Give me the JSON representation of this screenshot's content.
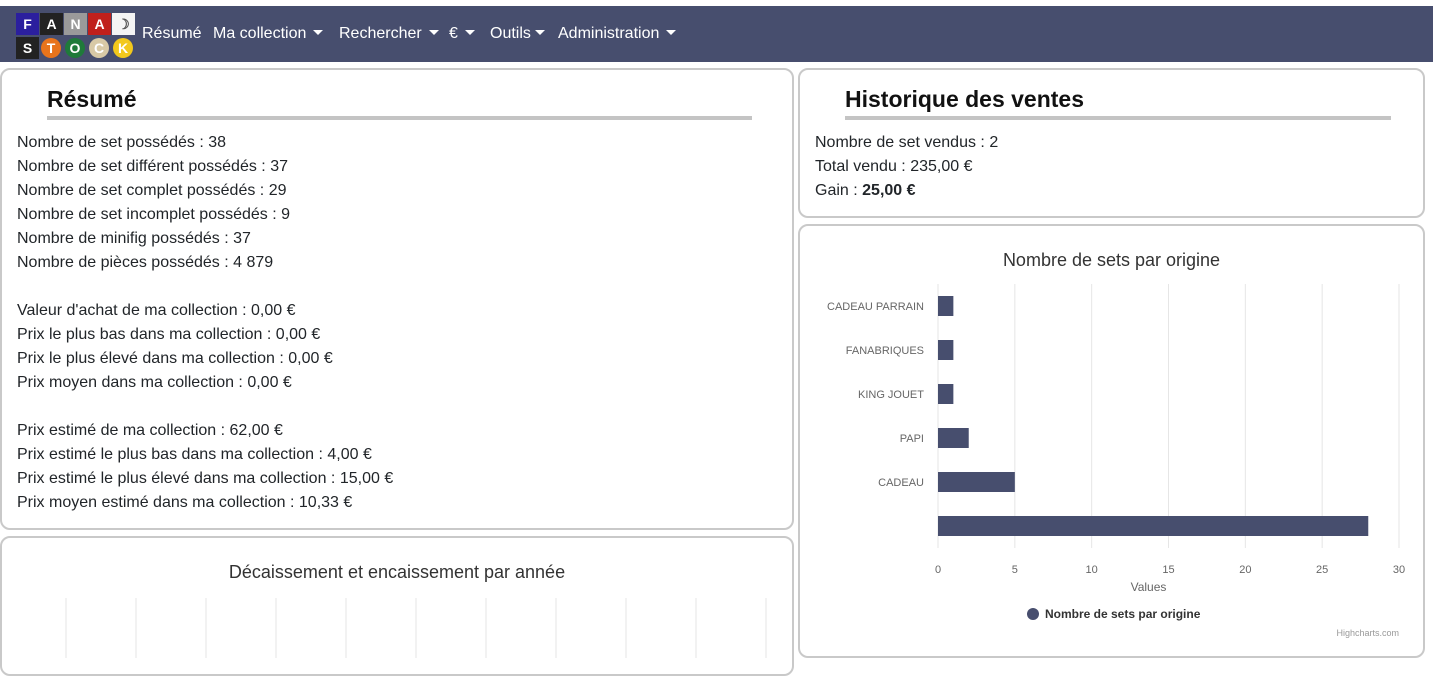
{
  "nav": {
    "brand_letters": [
      "F",
      "A",
      "N",
      "A",
      "S",
      "T",
      "O",
      "C",
      "K"
    ],
    "items": [
      {
        "label": "Résumé",
        "dropdown": false
      },
      {
        "label": "Ma collection",
        "dropdown": true
      },
      {
        "label": "Rechercher",
        "dropdown": true
      },
      {
        "label": "€",
        "dropdown": true
      },
      {
        "label": "Outils",
        "dropdown": true
      },
      {
        "label": "Administration",
        "dropdown": true
      }
    ],
    "background_color": "#474e6e"
  },
  "summary": {
    "title": "Résumé",
    "lines": [
      {
        "label": "Nombre de set possédés",
        "value": "38"
      },
      {
        "label": "Nombre de set différent possédés",
        "value": "37"
      },
      {
        "label": "Nombre de set complet possédés",
        "value": "29"
      },
      {
        "label": "Nombre de set incomplet possédés",
        "value": "9"
      },
      {
        "label": "Nombre de minifig possédés",
        "value": "37"
      },
      {
        "label": "Nombre de pièces possédés",
        "value": "4 879"
      },
      {
        "label": "Valeur d'achat de ma collection",
        "value": "0,00 €"
      },
      {
        "label": "Prix le plus bas dans ma collection",
        "value": "0,00 €"
      },
      {
        "label": "Prix le plus élevé dans ma collection",
        "value": "0,00 €"
      },
      {
        "label": "Prix moyen dans ma collection",
        "value": "0,00 €"
      },
      {
        "label": "Prix estimé de ma collection",
        "value": "62,00 €"
      },
      {
        "label": "Prix estimé le plus bas dans ma collection",
        "value": "4,00 €"
      },
      {
        "label": "Prix estimé le plus élevé dans ma collection",
        "value": "15,00 €"
      },
      {
        "label": "Prix moyen estimé dans ma collection",
        "value": "10,33 €"
      }
    ]
  },
  "sales": {
    "title": "Historique des ventes",
    "lines": [
      {
        "label": "Nombre de set vendus",
        "value": "2"
      },
      {
        "label": "Total vendu",
        "value": "235,00 €"
      },
      {
        "label": "Gain",
        "value": "25,00 €"
      }
    ]
  },
  "cashflow_chart": {
    "title": "Décaissement et encaissement par année"
  },
  "chart_data": {
    "type": "bar",
    "orientation": "horizontal",
    "title": "Nombre de sets par origine",
    "categories": [
      "CADEAU PARRAIN",
      "FANABRIQUES",
      "KING JOUET",
      "PAPI",
      "CADEAU",
      ""
    ],
    "series": [
      {
        "name": "Nombre de sets par origine",
        "values": [
          1,
          1,
          1,
          2,
          5,
          28
        ]
      }
    ],
    "xlabel": "Values",
    "xlim": [
      0,
      30
    ],
    "ticks": [
      0,
      5,
      10,
      15,
      20,
      25,
      30
    ],
    "grid": true,
    "legend_position": "bottom",
    "bar_color": "#474e6e",
    "credit": "Highcharts.com"
  }
}
